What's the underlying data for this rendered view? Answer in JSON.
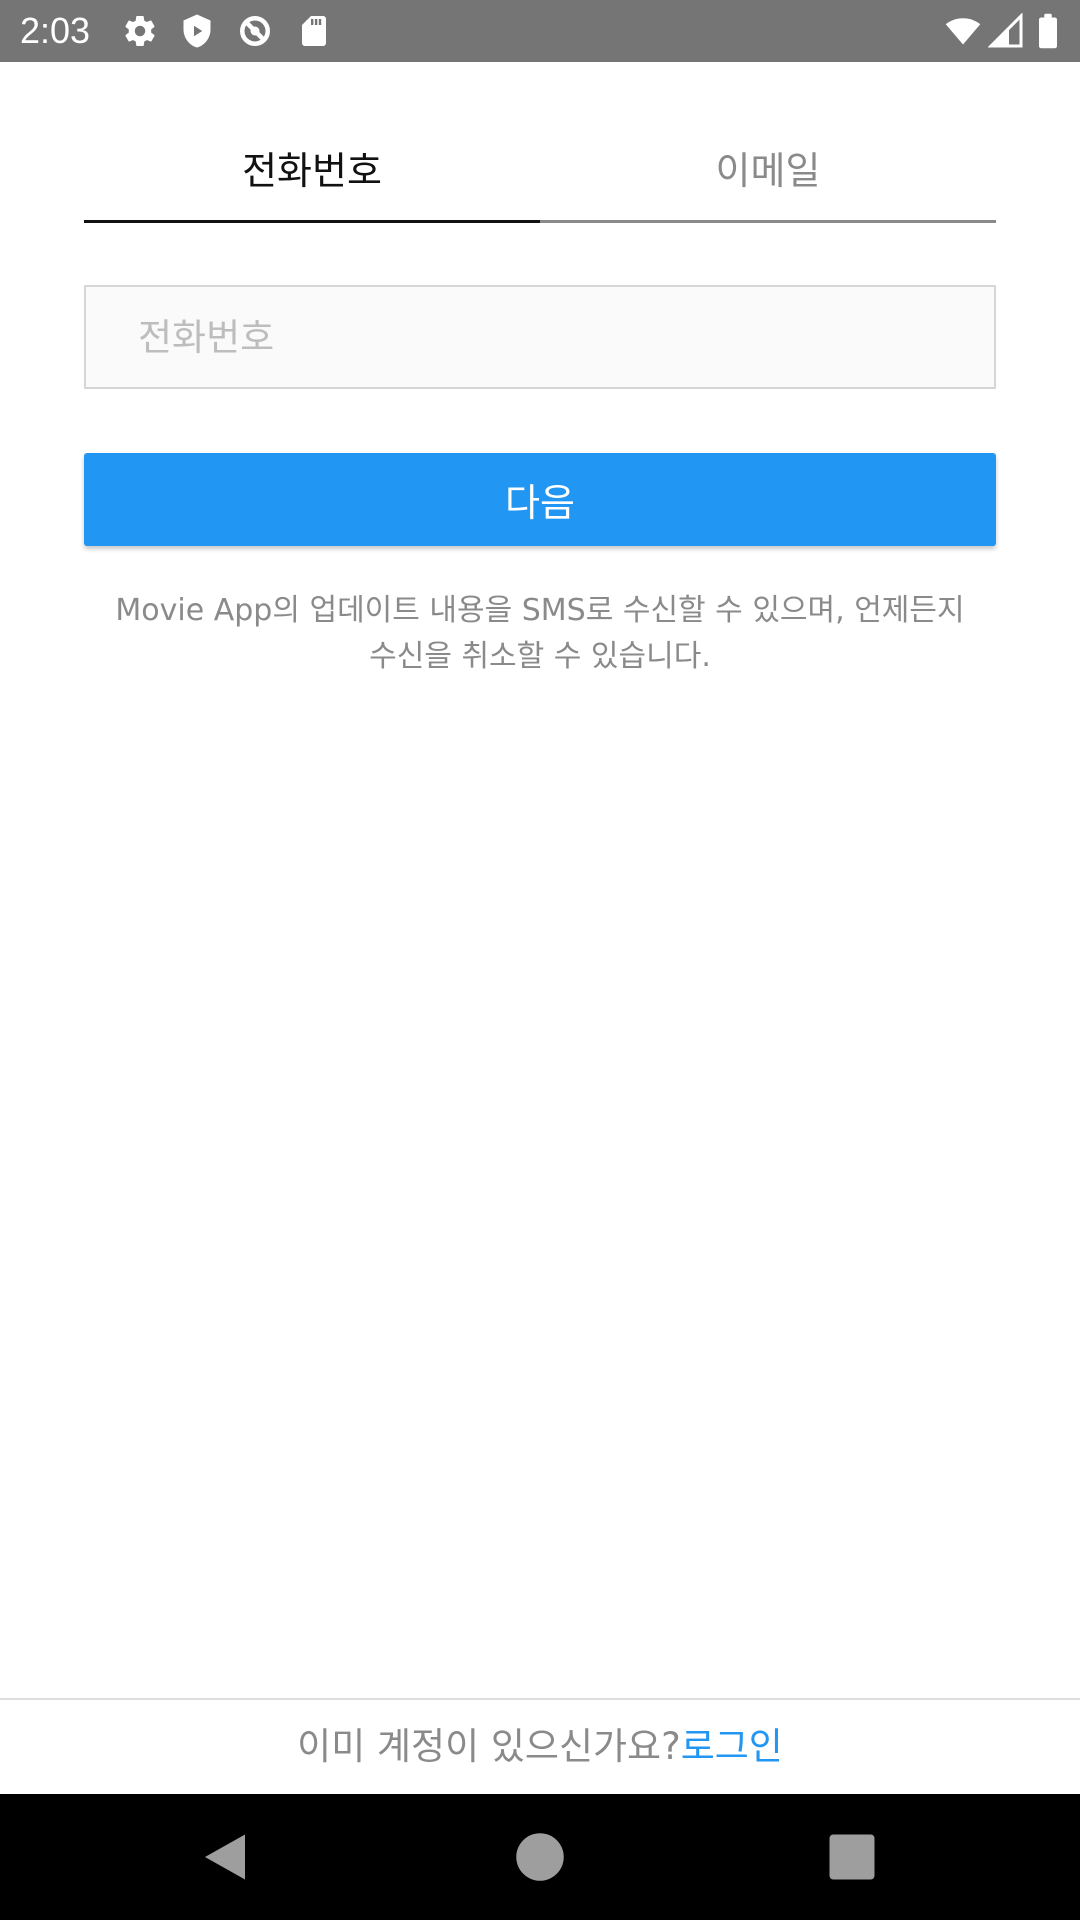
{
  "status_bar": {
    "time": "2:03",
    "icons": [
      "settings-icon",
      "shield-play-icon",
      "no-sync-icon",
      "sd-card-icon",
      "wifi-icon",
      "cell-signal-icon",
      "battery-icon"
    ]
  },
  "tabs": [
    {
      "label": "전화번호",
      "active": true
    },
    {
      "label": "이메일",
      "active": false
    }
  ],
  "phone_input": {
    "value": "",
    "placeholder": "전화번호"
  },
  "next_button": {
    "label": "다음"
  },
  "notice": {
    "line1": "Movie App의 업데이트 내용을 SMS로 수신할 수 있으며, 언제든지",
    "line2": "수신을 취소할 수 있습니다."
  },
  "footer": {
    "prompt": "이미 계정이 있으신가요?",
    "login_link": "로그인"
  },
  "nav_bar": {
    "buttons": [
      "back-icon",
      "home-icon",
      "recents-icon"
    ]
  },
  "colors": {
    "accent": "#2196f3",
    "status_bar": "#757575",
    "tab_active": "#111111",
    "tab_inactive": "#8a8a8a"
  }
}
